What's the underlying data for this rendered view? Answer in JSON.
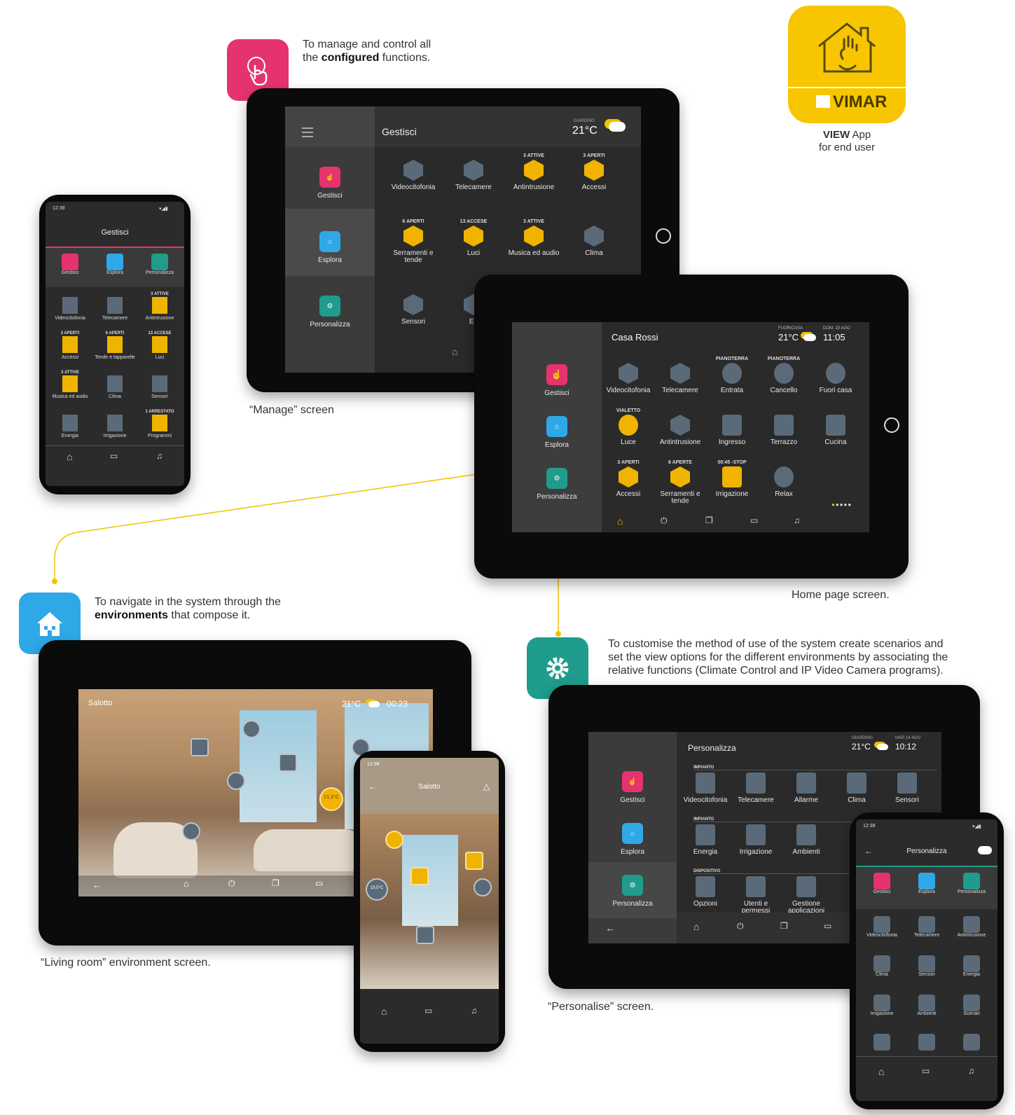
{
  "app_logo": {
    "brand": "VIMAR",
    "caption_bold": "VIEW",
    "caption_rest": " App",
    "caption_line2": "for end user",
    "color": "#f7c600"
  },
  "manage": {
    "callout_line1": "To manage and control all",
    "callout_pre": "the ",
    "callout_bold": "configured",
    "callout_post": " functions.",
    "caption": "“Manage” screen",
    "screen_title": "Gestisci",
    "weather_label": "GIARDINO",
    "temperature": "21°C",
    "side": [
      "Gestisci",
      "Esplora",
      "Personalizza"
    ],
    "tiles": [
      {
        "sub": "",
        "label": "Videocitofonia"
      },
      {
        "sub": "",
        "label": "Telecamere"
      },
      {
        "sub": "3 ATTIVE",
        "label": "Antintrusione"
      },
      {
        "sub": "3 APERTI",
        "label": "Accessi"
      },
      {
        "sub": "6 APERTI",
        "label": "Serramenti e tende"
      },
      {
        "sub": "13 ACCESE",
        "label": "Luci"
      },
      {
        "sub": "3 ATTIVE",
        "label": "Musica ed audio"
      },
      {
        "sub": "",
        "label": "Clima"
      },
      {
        "sub": "",
        "label": "Sensori"
      },
      {
        "sub": "",
        "label": "En"
      }
    ]
  },
  "phone_manage": {
    "time": "12:38",
    "title": "Gestisci",
    "tabs": [
      "Gestisci",
      "Esplora",
      "Personalizza"
    ],
    "tiles": [
      {
        "sub": "",
        "label": "Videocitofonia"
      },
      {
        "sub": "",
        "label": "Telecamere"
      },
      {
        "sub": "3 ATTIVE",
        "label": "Antintrusione"
      },
      {
        "sub": "3 APERTI",
        "label": "Accessi"
      },
      {
        "sub": "6 APERTI",
        "label": "Tende e tapparelle"
      },
      {
        "sub": "13 ACCESE",
        "label": "Luci"
      },
      {
        "sub": "3 ATTIVE",
        "label": "Musica ed audio"
      },
      {
        "sub": "",
        "label": "Clima"
      },
      {
        "sub": "",
        "label": "Sensori"
      },
      {
        "sub": "",
        "label": "Energia"
      },
      {
        "sub": "",
        "label": "Irrigazione"
      },
      {
        "sub": "1 ARRESTATO",
        "label": "Programmi"
      }
    ]
  },
  "home": {
    "caption": "Home page screen.",
    "title": "Casa Rossi",
    "weather_label": "FUORICASA",
    "temperature": "21°C",
    "date": "DOM. 19 AGO",
    "time": "11:05",
    "side": [
      "Gestisci",
      "Esplora",
      "Personalizza"
    ],
    "tiles": [
      {
        "sub": "",
        "label": "Videocitofonia"
      },
      {
        "sub": "",
        "label": "Telecamere"
      },
      {
        "sub": "PIANOTERRA",
        "label": "Entrata"
      },
      {
        "sub": "PIANOTERRA",
        "label": "Cancello"
      },
      {
        "sub": "",
        "label": "Fuori casa"
      },
      {
        "sub": "VIALETTO",
        "label": "Luce"
      },
      {
        "sub": "",
        "label": "Antintrusione"
      },
      {
        "sub": "",
        "label": "Ingresso"
      },
      {
        "sub": "",
        "label": "Terrazzo"
      },
      {
        "sub": "",
        "label": "Cucina"
      },
      {
        "sub": "3 APERTI",
        "label": "Accessi"
      },
      {
        "sub": "6 APERTE",
        "label": "Serramenti e tende"
      },
      {
        "sub": "00:45 -STOP",
        "label": "Irrigazione"
      },
      {
        "sub": "",
        "label": "Relax"
      }
    ]
  },
  "explore": {
    "callout_line1": "To navigate in the system through the",
    "callout_bold": "environments",
    "callout_post": " that compose it.",
    "caption": "“Living room” environment screen.",
    "room": "Salotto",
    "temperature": "21°C",
    "time": "00:23",
    "thermo": "21,3°C",
    "phone_time": "12:38",
    "phone_room": "Salotto",
    "phone_thermo": "19,5°C"
  },
  "personalise": {
    "callout_line1": "To customise the method of use of the system create scenarios and",
    "callout_line2": "set the view options for the different environments by associating the",
    "callout_line3": "relative functions (Climate Control and IP Video Camera programs).",
    "caption": "“Personalise” screen.",
    "screen_title": "Personalizza",
    "weather_label": "GIARDINO",
    "temperature": "21°C",
    "date": "MAR 14 NOV",
    "time": "10:12",
    "side": [
      "Gestisci",
      "Esplora",
      "Personalizza"
    ],
    "sections": [
      "IMPIANTO",
      "IMPIANTO",
      "DISPOSITIVO"
    ],
    "tiles": [
      {
        "label": "Videocitofonia"
      },
      {
        "label": "Telecamere"
      },
      {
        "label": "Allarme"
      },
      {
        "label": "Clima"
      },
      {
        "label": "Sensori"
      },
      {
        "label": "Energia"
      },
      {
        "label": "Irrigazione"
      },
      {
        "label": "Ambienti"
      },
      {
        "label": "Opzioni"
      },
      {
        "label": "Utenti e permessi"
      },
      {
        "label": "Gestione applicazioni"
      }
    ],
    "phone_time": "12:38",
    "phone_title": "Personalizza",
    "phone_tabs": [
      "Gestisci",
      "Esplora",
      "Personalizza"
    ],
    "phone_tiles": [
      {
        "label": "Videocitofonia"
      },
      {
        "label": "Telecamere"
      },
      {
        "label": "Antintrusione"
      },
      {
        "label": "Clima"
      },
      {
        "label": "Sensori"
      },
      {
        "label": "Energia"
      },
      {
        "label": "Irrigazione"
      },
      {
        "label": "Ambienti"
      },
      {
        "label": "Scenari"
      }
    ]
  },
  "colors": {
    "manage": "#e5336e",
    "explore": "#2fa8e8",
    "personalise": "#1f9c8c",
    "accent": "#f2c200"
  }
}
